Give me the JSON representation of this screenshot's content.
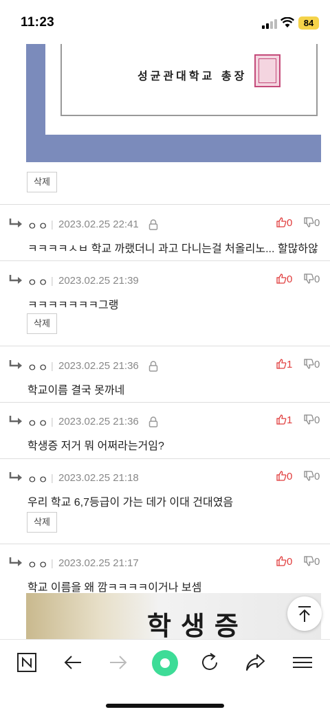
{
  "status_bar": {
    "time": "11:23",
    "battery": "84"
  },
  "certificate": {
    "issuer": "성균관대학교 총장"
  },
  "delete_label": "삭제",
  "comments": [
    {
      "author": "ㅇㅇ",
      "date": "2023.02.25 22:41",
      "likes": "0",
      "dislikes": "0",
      "text": "ㅋㅋㅋㅋㅅㅂ 학교 까랬더니 과고 다니는걸 처올리노... 할많하않"
    },
    {
      "author": "ㅇㅇ",
      "date": "2023.02.25 21:39",
      "likes": "0",
      "dislikes": "0",
      "text": "ㅋㅋㅋㅋㅋㅋㅋ그랭"
    },
    {
      "author": "ㅇㅇ",
      "date": "2023.02.25 21:36",
      "likes": "1",
      "dislikes": "0",
      "text": "학교이름 결국 못까네"
    },
    {
      "author": "ㅇㅇ",
      "date": "2023.02.25 21:36",
      "likes": "1",
      "dislikes": "0",
      "text": "학생증 저거 뭐 어쩌라는거임?"
    },
    {
      "author": "ㅇㅇ",
      "date": "2023.02.25 21:18",
      "likes": "0",
      "dislikes": "0",
      "text": "우리 학교 6,7등급이 가는 데가 이대 건대였음"
    },
    {
      "author": "ㅇㅇ",
      "date": "2023.02.25 21:17",
      "likes": "0",
      "dislikes": "0",
      "text": "학교 이름을 왜 깜ㅋㅋㅋㅋ이거나 보셈"
    }
  ],
  "student_card_text": "학생증",
  "icons": [
    "signal-icon",
    "wifi-icon",
    "battery-icon",
    "reply-arrow-icon",
    "lock-icon",
    "thumbs-up-icon",
    "thumbs-down-icon",
    "arrow-up-icon",
    "naver-n-icon",
    "back-arrow-icon",
    "forward-arrow-icon",
    "green-dot-icon",
    "refresh-icon",
    "share-icon",
    "menu-icon"
  ],
  "colors": {
    "like": "#e03b3b",
    "accent_green": "#3ddc97",
    "cert_blue": "#7b8bbb"
  }
}
